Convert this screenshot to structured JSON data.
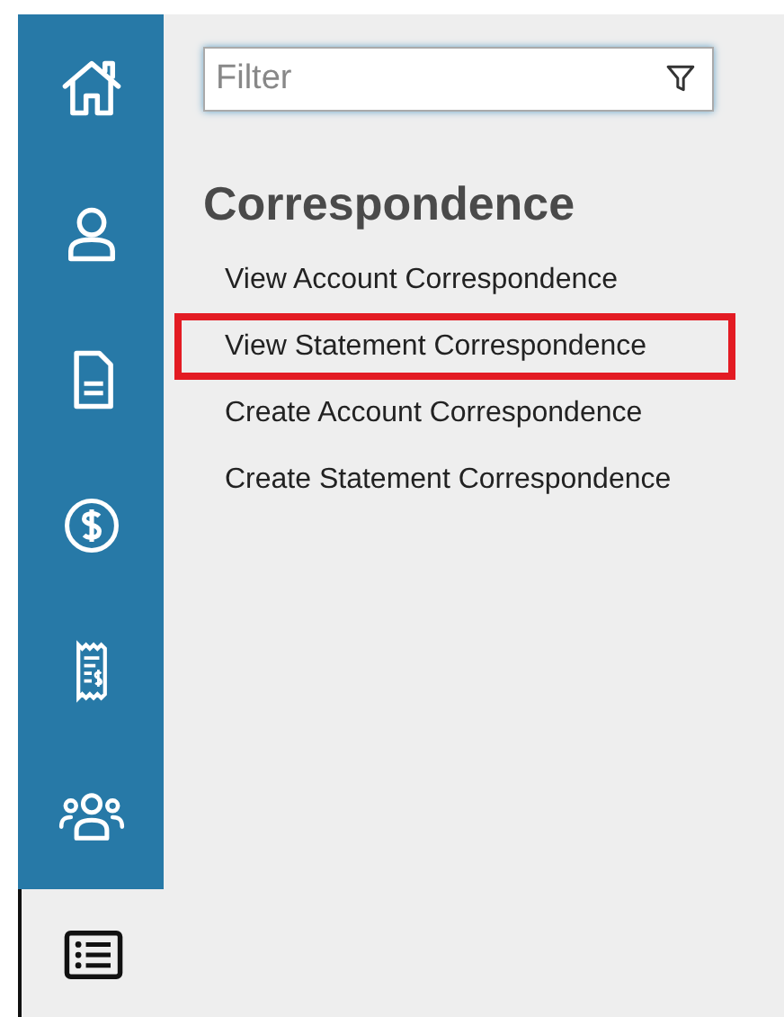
{
  "sidebar": {
    "items": [
      {
        "selected": false
      },
      {
        "selected": false
      },
      {
        "selected": false
      },
      {
        "selected": false
      },
      {
        "selected": false
      },
      {
        "selected": false
      },
      {
        "selected": true
      }
    ]
  },
  "filter": {
    "placeholder": "Filter"
  },
  "section": {
    "title": "Correspondence",
    "links": [
      {
        "label": "View Account Correspondence",
        "highlighted": false
      },
      {
        "label": "View Statement Correspondence",
        "highlighted": true
      },
      {
        "label": "Create Account Correspondence",
        "highlighted": false
      },
      {
        "label": "Create Statement Correspondence",
        "highlighted": false
      }
    ]
  }
}
